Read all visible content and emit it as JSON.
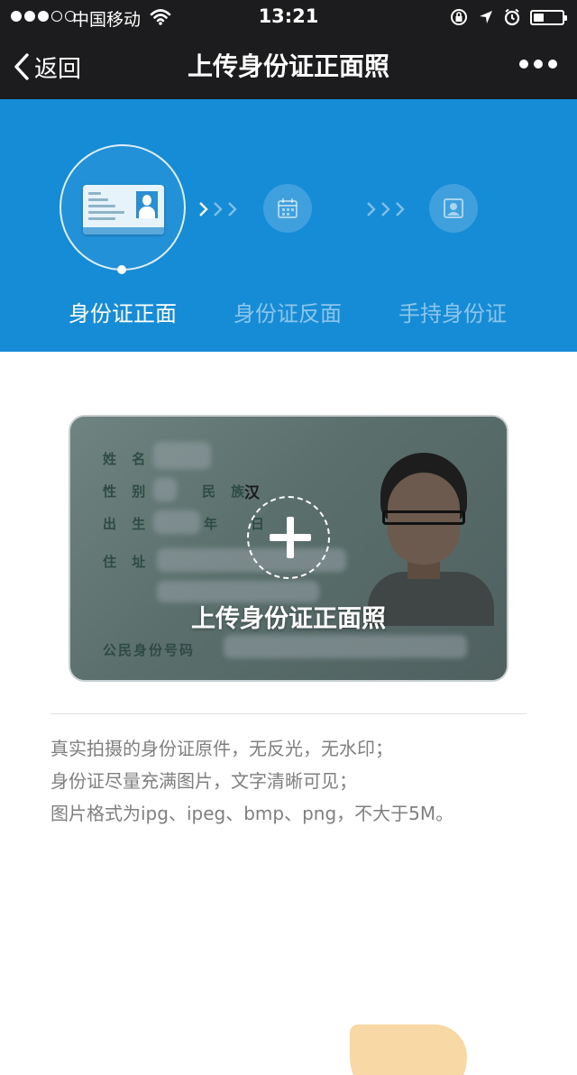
{
  "status_bar": {
    "carrier": "中国移动",
    "time": "13:21",
    "battery_level": 0.35
  },
  "nav": {
    "back_label": "返回",
    "title": "上传身份证正面照"
  },
  "steps": [
    {
      "label": "身份证正面",
      "active": true
    },
    {
      "label": "身份证反面",
      "active": false
    },
    {
      "label": "手持身份证",
      "active": false
    }
  ],
  "id_card": {
    "fields": {
      "name": "姓 名",
      "gender": "性 别",
      "ethnicity": "民 族",
      "ethnicity_value": "汉",
      "birth": "出 生",
      "year": "年",
      "day": "日",
      "address": "住 址",
      "id_number": "公民身份号码"
    },
    "upload_label": "上传身份证正面照"
  },
  "tips": [
    "真实拍摄的身份证原件，无反光，无水印；",
    "身份证尽量充满图片，文字清晰可见；",
    "图片格式为ipg、ipeg、bmp、png，不大于5M。"
  ],
  "colors": {
    "header_blue": "#168bd6",
    "dark_bar": "#1c1c1e",
    "tip_text": "#7f7f7f"
  }
}
